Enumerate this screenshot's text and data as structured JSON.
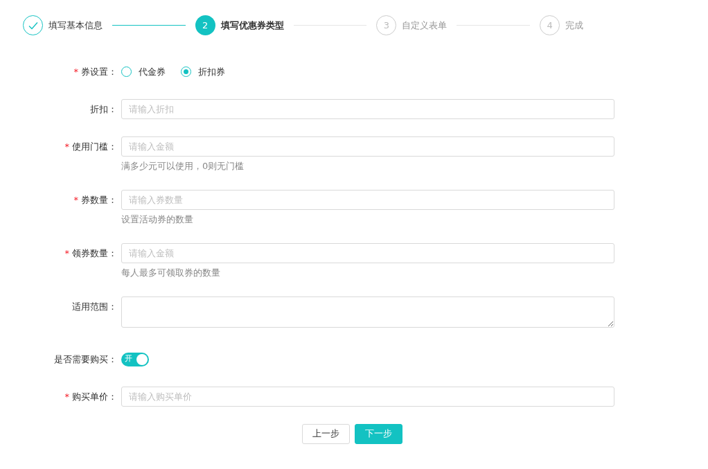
{
  "steps": [
    {
      "label": "填写基本信息",
      "done": true,
      "current": false
    },
    {
      "number": "2",
      "label": "填写优惠券类型",
      "done": false,
      "current": true
    },
    {
      "number": "3",
      "label": "自定义表单",
      "done": false,
      "current": false
    },
    {
      "number": "4",
      "label": "完成",
      "done": false,
      "current": false
    }
  ],
  "form": [
    {
      "kind": "radio",
      "label": "券设置：",
      "required_mark": "*",
      "options": [
        {
          "label": "代金券",
          "selected": false
        },
        {
          "label": "折扣券",
          "selected": true
        }
      ]
    },
    {
      "kind": "input",
      "label": "折扣：",
      "placeholder": "请输入折扣"
    },
    {
      "kind": "input",
      "label": "使用门槛：",
      "required_mark": "*",
      "placeholder": "请输入金额",
      "hint": "满多少元可以使用，0则无门槛"
    },
    {
      "kind": "input",
      "label": "券数量：",
      "required_mark": "*",
      "placeholder": "请输入券数量",
      "hint": "设置活动券的数量"
    },
    {
      "kind": "input",
      "label": "领券数量：",
      "required_mark": "*",
      "placeholder": "请输入金额",
      "hint": "每人最多可领取券的数量"
    },
    {
      "kind": "textarea",
      "label": "适用范围："
    },
    {
      "kind": "switch",
      "label": "是否需要购买：",
      "on": true,
      "text": "开"
    },
    {
      "kind": "input",
      "label": "购买单价：",
      "required_mark": "*",
      "placeholder": "请输入购买单价"
    }
  ],
  "buttons": [
    {
      "label": "上一步",
      "primary": false
    },
    {
      "label": "下一步",
      "primary": true
    }
  ]
}
